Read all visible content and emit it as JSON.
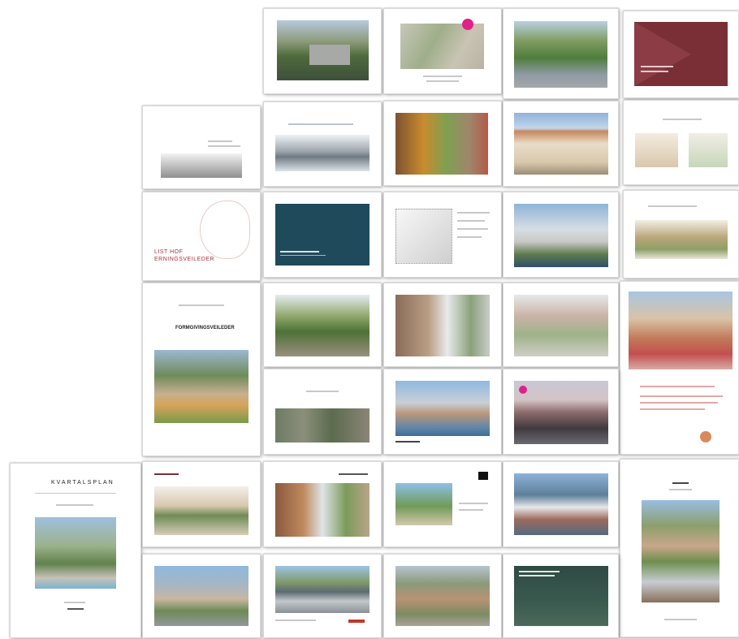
{
  "sheets": {
    "r3c1": {
      "line1": "LIST HOF",
      "line2": "ERNINGSVEILEDER"
    },
    "r4c1": {
      "heading": "FORMGIVINGSVEILEDER"
    },
    "r5c0": {
      "heading": "KVARTALSPLAN"
    }
  },
  "colors": {
    "burgundy": "#7a2f37",
    "teal": "#1f4a5c",
    "dark_green": "#2f4a43",
    "accent_red": "#c0392b",
    "magenta": "#e0218a"
  }
}
